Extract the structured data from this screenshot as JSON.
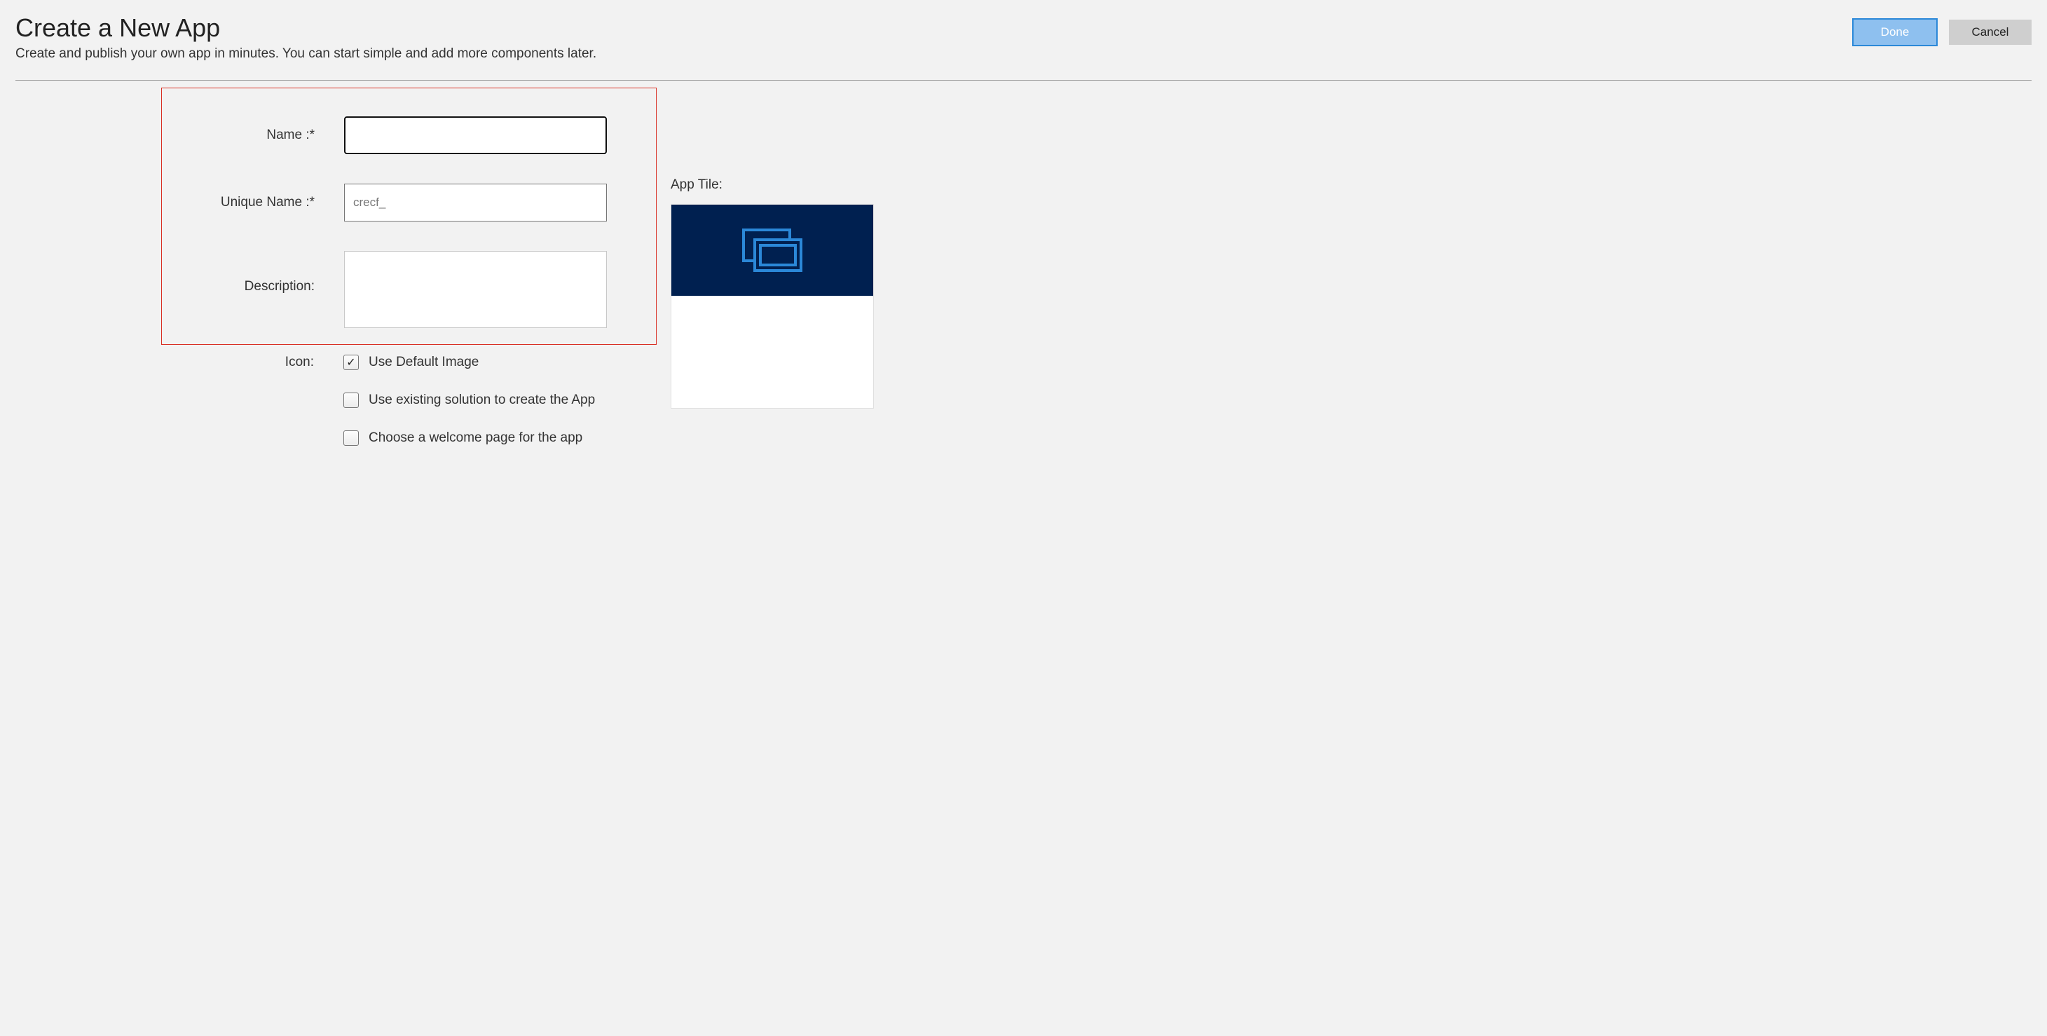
{
  "header": {
    "title": "Create a New App",
    "subtitle": "Create and publish your own app in minutes. You can start simple and add more components later.",
    "done_label": "Done",
    "cancel_label": "Cancel"
  },
  "form": {
    "name_label": "Name :*",
    "name_value": "",
    "unique_name_label": "Unique Name :*",
    "unique_name_value": "crecf_",
    "description_label": "Description:",
    "description_value": "",
    "icon_label": "Icon:",
    "use_default_image_label": "Use Default Image",
    "use_default_image_checked": true,
    "use_existing_solution_label": "Use existing solution to create the App",
    "use_existing_solution_checked": false,
    "choose_welcome_page_label": "Choose a welcome page for the app",
    "choose_welcome_page_checked": false
  },
  "tile": {
    "label": "App Tile:",
    "header_color": "#002050",
    "icon_color": "#2b88d8"
  }
}
